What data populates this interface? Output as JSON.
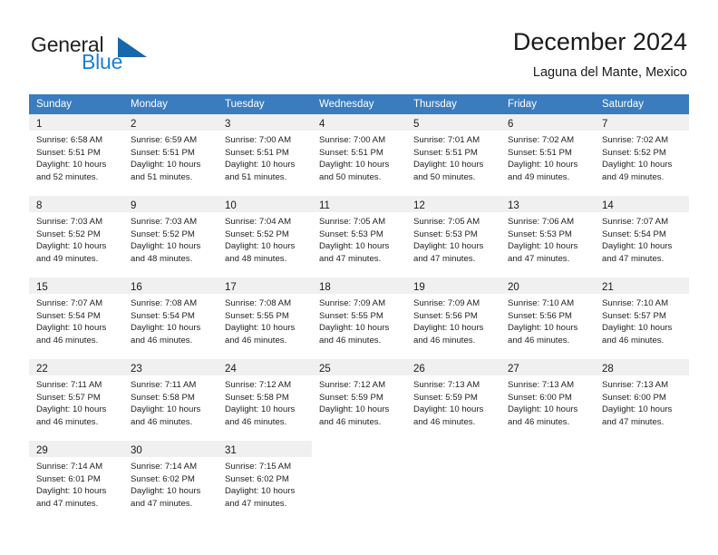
{
  "brand": {
    "name_part1": "General",
    "name_part2": "Blue",
    "triangle_color": "#1667ab",
    "accent_color": "#1b7fd4"
  },
  "header": {
    "title": "December 2024",
    "location": "Laguna del Mante, Mexico"
  },
  "theme": {
    "header_row_bg": "#3a7cbd",
    "header_row_text": "#ffffff",
    "daynum_band_bg": "#f0f0f0",
    "cell_bg": "#ffffff",
    "page_bg": "#ffffff"
  },
  "weekdays": [
    "Sunday",
    "Monday",
    "Tuesday",
    "Wednesday",
    "Thursday",
    "Friday",
    "Saturday"
  ],
  "weeks": [
    [
      {
        "day": "1",
        "sunrise": "Sunrise: 6:58 AM",
        "sunset": "Sunset: 5:51 PM",
        "daylight1": "Daylight: 10 hours",
        "daylight2": "and 52 minutes."
      },
      {
        "day": "2",
        "sunrise": "Sunrise: 6:59 AM",
        "sunset": "Sunset: 5:51 PM",
        "daylight1": "Daylight: 10 hours",
        "daylight2": "and 51 minutes."
      },
      {
        "day": "3",
        "sunrise": "Sunrise: 7:00 AM",
        "sunset": "Sunset: 5:51 PM",
        "daylight1": "Daylight: 10 hours",
        "daylight2": "and 51 minutes."
      },
      {
        "day": "4",
        "sunrise": "Sunrise: 7:00 AM",
        "sunset": "Sunset: 5:51 PM",
        "daylight1": "Daylight: 10 hours",
        "daylight2": "and 50 minutes."
      },
      {
        "day": "5",
        "sunrise": "Sunrise: 7:01 AM",
        "sunset": "Sunset: 5:51 PM",
        "daylight1": "Daylight: 10 hours",
        "daylight2": "and 50 minutes."
      },
      {
        "day": "6",
        "sunrise": "Sunrise: 7:02 AM",
        "sunset": "Sunset: 5:51 PM",
        "daylight1": "Daylight: 10 hours",
        "daylight2": "and 49 minutes."
      },
      {
        "day": "7",
        "sunrise": "Sunrise: 7:02 AM",
        "sunset": "Sunset: 5:52 PM",
        "daylight1": "Daylight: 10 hours",
        "daylight2": "and 49 minutes."
      }
    ],
    [
      {
        "day": "8",
        "sunrise": "Sunrise: 7:03 AM",
        "sunset": "Sunset: 5:52 PM",
        "daylight1": "Daylight: 10 hours",
        "daylight2": "and 49 minutes."
      },
      {
        "day": "9",
        "sunrise": "Sunrise: 7:03 AM",
        "sunset": "Sunset: 5:52 PM",
        "daylight1": "Daylight: 10 hours",
        "daylight2": "and 48 minutes."
      },
      {
        "day": "10",
        "sunrise": "Sunrise: 7:04 AM",
        "sunset": "Sunset: 5:52 PM",
        "daylight1": "Daylight: 10 hours",
        "daylight2": "and 48 minutes."
      },
      {
        "day": "11",
        "sunrise": "Sunrise: 7:05 AM",
        "sunset": "Sunset: 5:53 PM",
        "daylight1": "Daylight: 10 hours",
        "daylight2": "and 47 minutes."
      },
      {
        "day": "12",
        "sunrise": "Sunrise: 7:05 AM",
        "sunset": "Sunset: 5:53 PM",
        "daylight1": "Daylight: 10 hours",
        "daylight2": "and 47 minutes."
      },
      {
        "day": "13",
        "sunrise": "Sunrise: 7:06 AM",
        "sunset": "Sunset: 5:53 PM",
        "daylight1": "Daylight: 10 hours",
        "daylight2": "and 47 minutes."
      },
      {
        "day": "14",
        "sunrise": "Sunrise: 7:07 AM",
        "sunset": "Sunset: 5:54 PM",
        "daylight1": "Daylight: 10 hours",
        "daylight2": "and 47 minutes."
      }
    ],
    [
      {
        "day": "15",
        "sunrise": "Sunrise: 7:07 AM",
        "sunset": "Sunset: 5:54 PM",
        "daylight1": "Daylight: 10 hours",
        "daylight2": "and 46 minutes."
      },
      {
        "day": "16",
        "sunrise": "Sunrise: 7:08 AM",
        "sunset": "Sunset: 5:54 PM",
        "daylight1": "Daylight: 10 hours",
        "daylight2": "and 46 minutes."
      },
      {
        "day": "17",
        "sunrise": "Sunrise: 7:08 AM",
        "sunset": "Sunset: 5:55 PM",
        "daylight1": "Daylight: 10 hours",
        "daylight2": "and 46 minutes."
      },
      {
        "day": "18",
        "sunrise": "Sunrise: 7:09 AM",
        "sunset": "Sunset: 5:55 PM",
        "daylight1": "Daylight: 10 hours",
        "daylight2": "and 46 minutes."
      },
      {
        "day": "19",
        "sunrise": "Sunrise: 7:09 AM",
        "sunset": "Sunset: 5:56 PM",
        "daylight1": "Daylight: 10 hours",
        "daylight2": "and 46 minutes."
      },
      {
        "day": "20",
        "sunrise": "Sunrise: 7:10 AM",
        "sunset": "Sunset: 5:56 PM",
        "daylight1": "Daylight: 10 hours",
        "daylight2": "and 46 minutes."
      },
      {
        "day": "21",
        "sunrise": "Sunrise: 7:10 AM",
        "sunset": "Sunset: 5:57 PM",
        "daylight1": "Daylight: 10 hours",
        "daylight2": "and 46 minutes."
      }
    ],
    [
      {
        "day": "22",
        "sunrise": "Sunrise: 7:11 AM",
        "sunset": "Sunset: 5:57 PM",
        "daylight1": "Daylight: 10 hours",
        "daylight2": "and 46 minutes."
      },
      {
        "day": "23",
        "sunrise": "Sunrise: 7:11 AM",
        "sunset": "Sunset: 5:58 PM",
        "daylight1": "Daylight: 10 hours",
        "daylight2": "and 46 minutes."
      },
      {
        "day": "24",
        "sunrise": "Sunrise: 7:12 AM",
        "sunset": "Sunset: 5:58 PM",
        "daylight1": "Daylight: 10 hours",
        "daylight2": "and 46 minutes."
      },
      {
        "day": "25",
        "sunrise": "Sunrise: 7:12 AM",
        "sunset": "Sunset: 5:59 PM",
        "daylight1": "Daylight: 10 hours",
        "daylight2": "and 46 minutes."
      },
      {
        "day": "26",
        "sunrise": "Sunrise: 7:13 AM",
        "sunset": "Sunset: 5:59 PM",
        "daylight1": "Daylight: 10 hours",
        "daylight2": "and 46 minutes."
      },
      {
        "day": "27",
        "sunrise": "Sunrise: 7:13 AM",
        "sunset": "Sunset: 6:00 PM",
        "daylight1": "Daylight: 10 hours",
        "daylight2": "and 46 minutes."
      },
      {
        "day": "28",
        "sunrise": "Sunrise: 7:13 AM",
        "sunset": "Sunset: 6:00 PM",
        "daylight1": "Daylight: 10 hours",
        "daylight2": "and 47 minutes."
      }
    ],
    [
      {
        "day": "29",
        "sunrise": "Sunrise: 7:14 AM",
        "sunset": "Sunset: 6:01 PM",
        "daylight1": "Daylight: 10 hours",
        "daylight2": "and 47 minutes."
      },
      {
        "day": "30",
        "sunrise": "Sunrise: 7:14 AM",
        "sunset": "Sunset: 6:02 PM",
        "daylight1": "Daylight: 10 hours",
        "daylight2": "and 47 minutes."
      },
      {
        "day": "31",
        "sunrise": "Sunrise: 7:15 AM",
        "sunset": "Sunset: 6:02 PM",
        "daylight1": "Daylight: 10 hours",
        "daylight2": "and 47 minutes."
      },
      null,
      null,
      null,
      null
    ]
  ]
}
